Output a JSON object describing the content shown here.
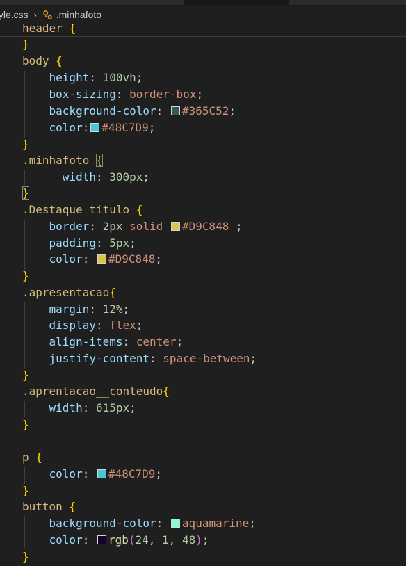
{
  "breadcrumb": {
    "file": "tyle.css",
    "separator": "›",
    "symbol": ".minhafoto"
  },
  "colors": {
    "selector": "#d7ba7d",
    "property": "#9cdcfe",
    "value": "#ce9178",
    "number": "#b5cea8",
    "function": "#dcdcaa",
    "bracket_1": "#ffd700",
    "bracket_2": "#da70d6"
  },
  "code": {
    "sticky": {
      "selector": "header",
      "brace": "{"
    },
    "header_close": "}",
    "body": {
      "selector": "body",
      "open": "{",
      "height": {
        "prop": "height",
        "value": "100vh"
      },
      "box_sizing": {
        "prop": "box-sizing",
        "value": "border-box"
      },
      "bg": {
        "prop": "background-color",
        "value": "#365C52",
        "swatch": "#365C52"
      },
      "color": {
        "prop": "color",
        "value": "#48C7D9",
        "swatch": "#48C7D9"
      },
      "close": "}"
    },
    "minhafoto": {
      "selector": ".minhafoto",
      "open": "{",
      "width": {
        "prop": "width",
        "value": "300px"
      },
      "close": "}"
    },
    "destaque": {
      "selector": ".Destaque_titulo",
      "open": "{",
      "border": {
        "prop": "border",
        "v1": "2px",
        "v2": "solid",
        "v3": "#D9C848",
        "swatch": "#D9C848",
        "end": " ;"
      },
      "padding": {
        "prop": "padding",
        "value": "5px"
      },
      "color": {
        "prop": "color",
        "value": "#D9C848",
        "swatch": "#D9C848"
      },
      "close": "}"
    },
    "apresentacao": {
      "selector": ".apresentacao",
      "open": "{",
      "margin": {
        "prop": "margin",
        "value": "12%"
      },
      "display": {
        "prop": "display",
        "value": "flex"
      },
      "align": {
        "prop": "align-items",
        "value": "center"
      },
      "justify": {
        "prop": "justify-content",
        "value": "space-between"
      },
      "close": "}"
    },
    "aprentacao_conteudo": {
      "selector": ".aprentacao__conteudo",
      "open": "{",
      "width": {
        "prop": "width",
        "value": "615px"
      },
      "close": "}"
    },
    "p": {
      "selector": "p",
      "open": "{",
      "color": {
        "prop": "color",
        "value": "#48C7D9",
        "swatch": "#48C7D9"
      },
      "close": "}"
    },
    "button": {
      "selector": "button",
      "open": "{",
      "bg": {
        "prop": "background-color",
        "value": "aquamarine",
        "swatch": "#7fffd4"
      },
      "color": {
        "prop": "color",
        "fn": "rgb",
        "paren_open": "(",
        "args": "24, 1, 48",
        "paren_close": ")",
        "swatch": "#180130"
      },
      "close": "}"
    }
  }
}
